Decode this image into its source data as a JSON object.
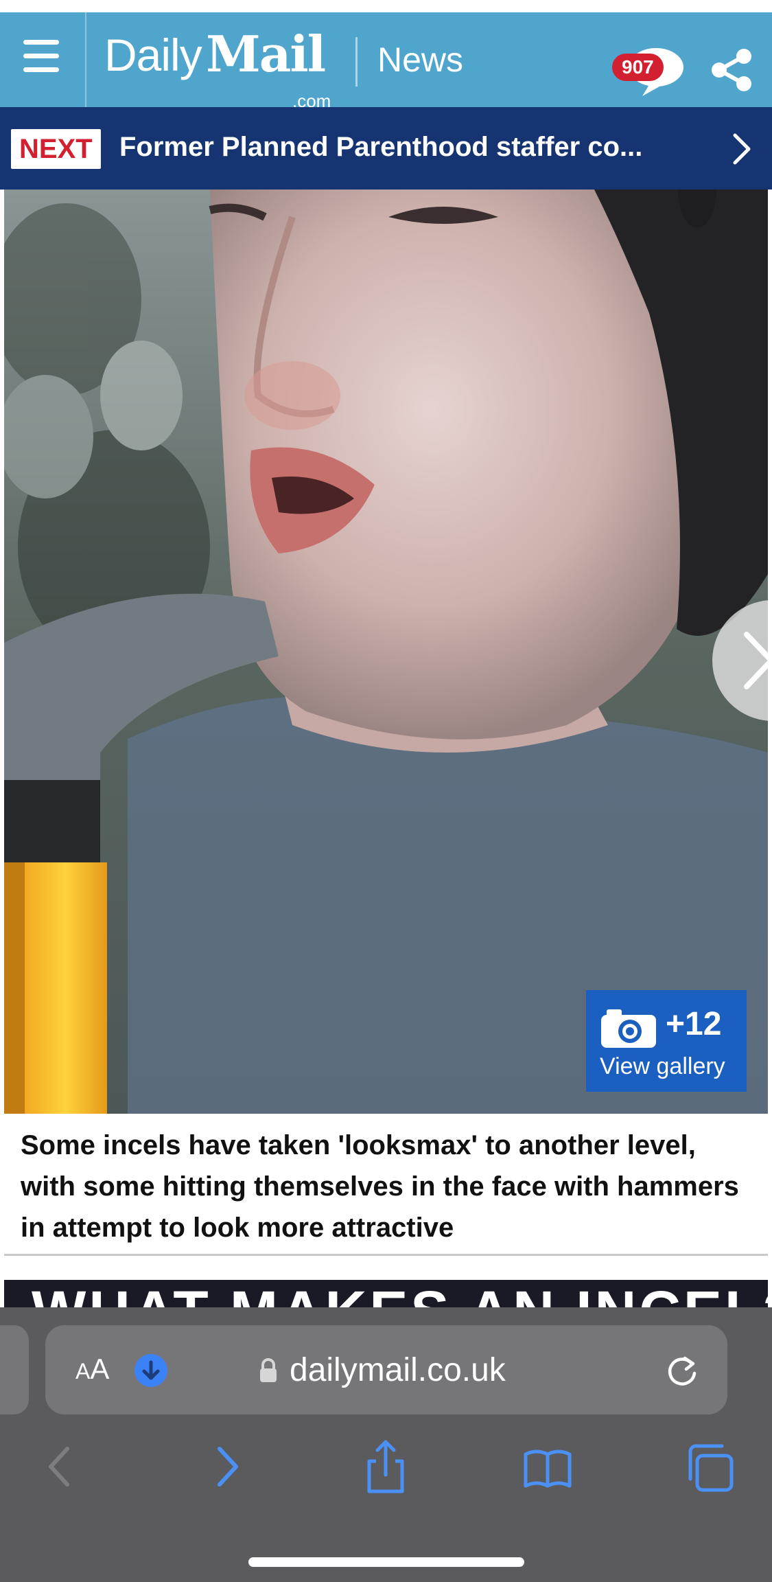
{
  "header": {
    "logo_daily": "Daily",
    "logo_mail": "Mail",
    "logo_dotcom": ".com",
    "section": "News",
    "comment_count": "907",
    "brand_color": "#4fa5cc"
  },
  "next_bar": {
    "badge": "NEXT",
    "title": "Former Planned Parenthood staffer co..."
  },
  "hero": {
    "gallery_count": "+12",
    "gallery_label": "View gallery"
  },
  "caption": {
    "text": "Some incels have taken 'looksmax' to another level, with some hitting themselves in the face with hammers in attempt to look more attractive"
  },
  "banner_peek": {
    "text": "WHAT MAKES AN INCEL?"
  },
  "safari": {
    "aa_label_small": "A",
    "aa_label": "A",
    "url": "dailymail.co.uk",
    "icons": [
      "back-icon",
      "forward-icon",
      "share-icon",
      "bookmarks-icon",
      "tabs-icon"
    ],
    "accent": "#3a82f6"
  }
}
